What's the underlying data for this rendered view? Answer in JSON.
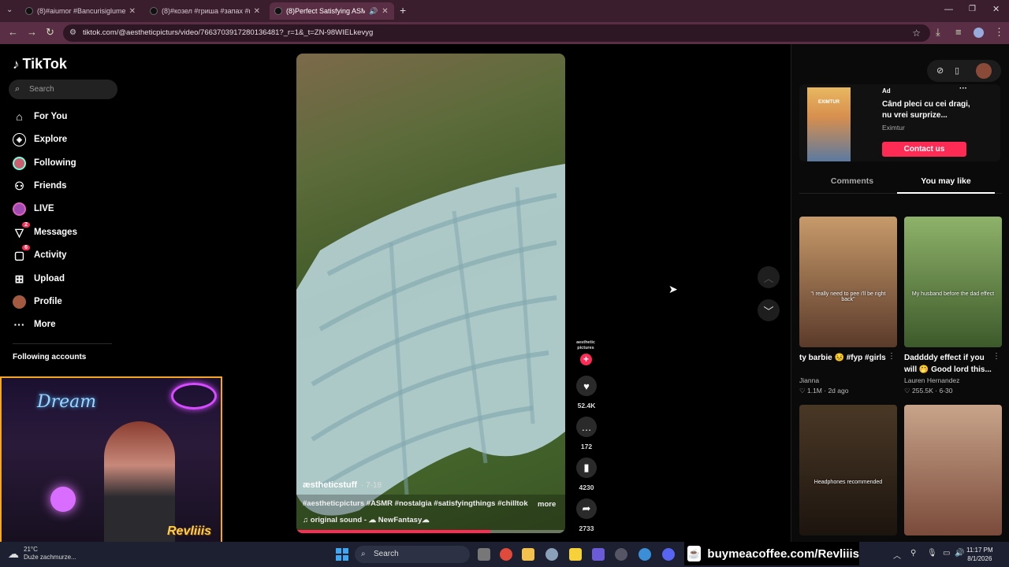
{
  "browser": {
    "tabs": [
      {
        "title": "(8)#aiumor #Bancurisiglume #r"
      },
      {
        "title": "(8)#козел #гриша #запах #rom"
      },
      {
        "title": "(8)Perfect Satisfying ASMR"
      }
    ],
    "new_tab": "+",
    "url": "tiktok.com/@aestheticpicturs/video/7663703917280136481?_r=1&_t=ZN-98WIELkevyg"
  },
  "sidebar": {
    "logo": "TikTok",
    "search_placeholder": "Search",
    "items": [
      {
        "label": "For You",
        "icon": "home-icon"
      },
      {
        "label": "Explore",
        "icon": "compass-icon"
      },
      {
        "label": "Following",
        "icon": "following-avatar-icon"
      },
      {
        "label": "Friends",
        "icon": "friends-icon"
      },
      {
        "label": "LIVE",
        "icon": "live-icon"
      },
      {
        "label": "Messages",
        "icon": "messages-icon",
        "badge": "2"
      },
      {
        "label": "Activity",
        "icon": "activity-icon",
        "badge": "6"
      },
      {
        "label": "Upload",
        "icon": "upload-icon"
      },
      {
        "label": "Profile",
        "icon": "profile-avatar-icon"
      },
      {
        "label": "More",
        "icon": "more-icon"
      }
    ],
    "following_title": "Following accounts"
  },
  "video": {
    "author": "æstheticstuff",
    "date": "· 7-18",
    "caption": "#aestheticpicturs #ASMR #nostalgia #satisfyingthings #chilltok",
    "more": "more",
    "sound": "original sound  -  ☁ NewFantasy☁",
    "progress": 0.72,
    "channel_badge": "aesthetic pictures",
    "likes": "52.4K",
    "comments": "172",
    "saves": "4230",
    "shares": "2733"
  },
  "right_panel": {
    "ad": {
      "label": "Ad",
      "thumb_text": "EXIMTUR",
      "title": "Când pleci cu cei dragi, nu vrei surprize...",
      "brand": "Eximtur",
      "cta": "Contact us"
    },
    "tabs": [
      "Comments",
      "You may like"
    ],
    "cards": [
      {
        "title": "ty barbie 😣 #fyp #girls",
        "author": "Jianna",
        "likes": "1.1M",
        "age": "2d ago",
        "overlay": "\"i really need to pee i'll be right back\"",
        "color1": "#c79a6a",
        "color2": "#5a3a2a"
      },
      {
        "title": "Daddddy effect if you will 🤭 Good lord this...",
        "author": "Lauren Hernandez",
        "likes": "255.5K",
        "age": "6-30",
        "overlay": "My husband before the dad effect",
        "color1": "#8fb26a",
        "color2": "#3c5a2a"
      },
      {
        "title": "",
        "author": "",
        "likes": "",
        "age": "",
        "overlay": "Headphones recommended",
        "color1": "#4a3826",
        "color2": "#1c140e"
      },
      {
        "title": "",
        "author": "",
        "likes": "",
        "age": "",
        "overlay": "",
        "color1": "#c8a48a",
        "color2": "#7a4a3a"
      }
    ]
  },
  "webcam": {
    "neon_text": "Dream",
    "streamer": "Revliiis"
  },
  "taskbar": {
    "weather_temp": "21°C",
    "weather_desc": "Duże zachmurze...",
    "search": "Search",
    "promo": "buymeacoffee.com/Revliiis",
    "time": "11:17 PM",
    "date": "8/1/2026"
  }
}
